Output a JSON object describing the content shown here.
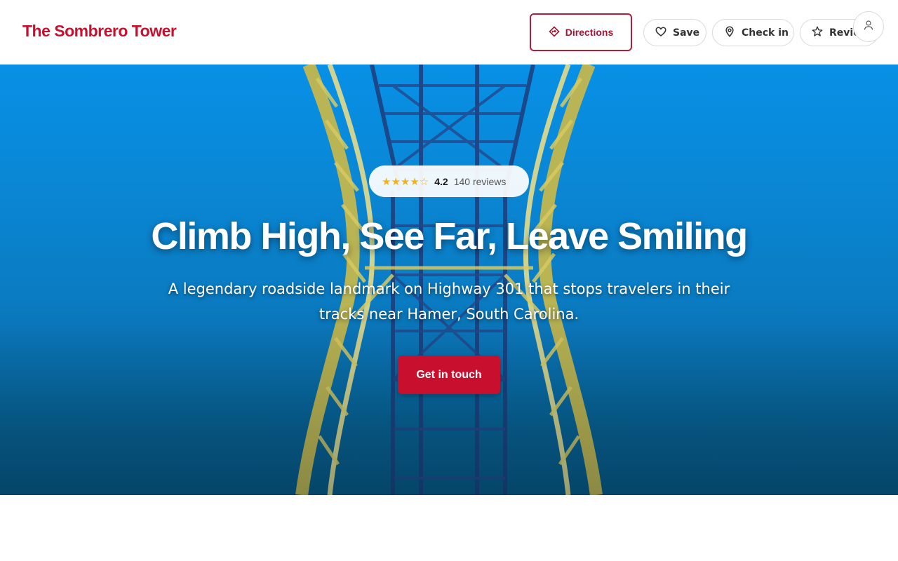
{
  "header": {
    "brand": "The Sombrero Tower",
    "directions_label": "Directions",
    "save_label": "Save",
    "checkin_label": "Check in",
    "review_label": "Review"
  },
  "hero": {
    "rating": {
      "stars": "★★★★☆",
      "value": "4.2",
      "reviews_text": "140 reviews"
    },
    "headline": "Climb High, See Far, Leave Smiling",
    "subtitle": "A legendary roadside landmark on Highway 301 that stops travelers in their tracks near Hamer, South Carolina.",
    "cta_label": "Get in touch"
  },
  "icons": {
    "directions": "directions-icon",
    "save": "heart-icon",
    "checkin": "map-pin-icon",
    "review": "star-icon",
    "account": "user-icon"
  },
  "colors": {
    "brand": "#c8102e",
    "star": "#f2b21b",
    "sky": "#0790e6"
  }
}
